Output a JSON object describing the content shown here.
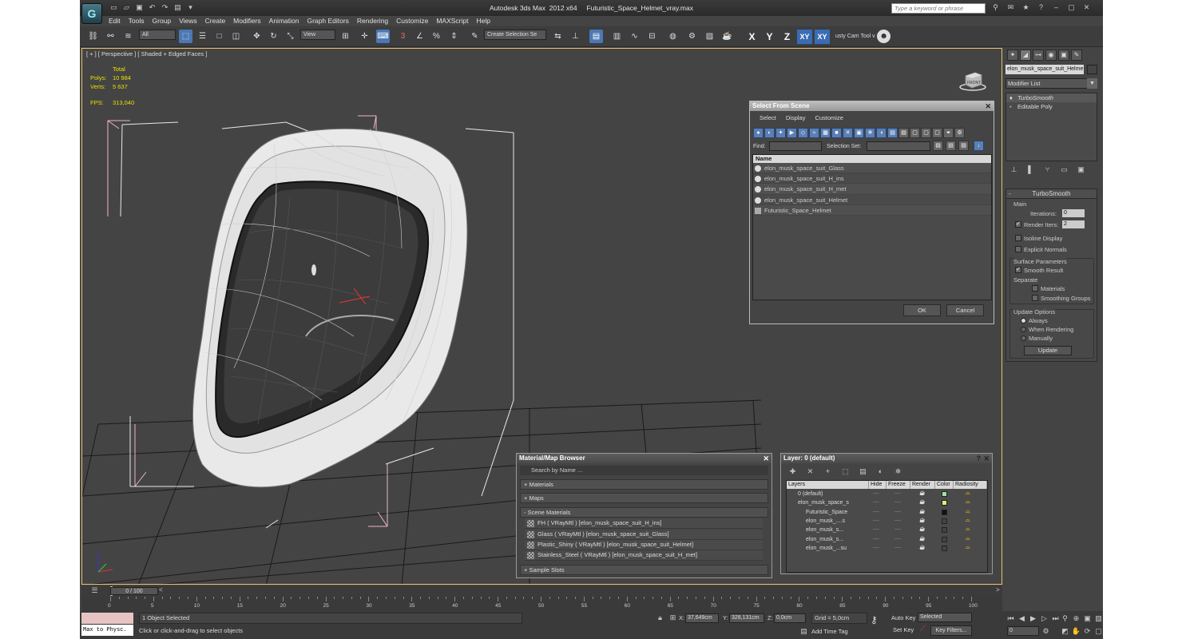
{
  "app": {
    "title": "Autodesk 3ds Max  2012 x64     Futuristic_Space_Helmet_vray.max",
    "search_placeholder": "Type a keyword or phrase",
    "logo": "3ds-max-logo"
  },
  "menu": [
    "Edit",
    "Tools",
    "Group",
    "Views",
    "Create",
    "Modifiers",
    "Animation",
    "Graph Editors",
    "Rendering",
    "Customize",
    "MAXScript",
    "Help"
  ],
  "toolbar": {
    "filter": "All",
    "ref_coord": "View",
    "create_selection_set": "Create Selection Se",
    "snap_label": "3",
    "axes": {
      "x": "X",
      "y": "Y",
      "z": "Z",
      "xy": "XY",
      "xy2": "XY"
    },
    "extra": "usty Cam Tool v"
  },
  "viewport": {
    "label": "[ + ] [ Perspective ] [ Shaded + Edged Faces ]",
    "stats": {
      "total_label": "Total",
      "polys_label": "Polys:",
      "polys": "10 984",
      "verts_label": "Verts:",
      "verts": "5 637",
      "fps_label": "FPS:",
      "fps": "313,040"
    },
    "viewcube_label": "FRONT"
  },
  "select_from_scene": {
    "title": "Select From Scene",
    "menu": [
      "Select",
      "Display",
      "Customize"
    ],
    "find_label": "Find:",
    "selection_set_label": "Selection Set:",
    "column": "Name",
    "rows": [
      "elon_musk_space_suit_Glass",
      "elon_musk_space_suit_H_ins",
      "elon_musk_space_suit_H_met",
      "elon_musk_space_suit_Helmet",
      "Futuristic_Space_Helmet"
    ],
    "ok": "OK",
    "cancel": "Cancel"
  },
  "command_panel": {
    "object_name": "elon_musk_space_suit_Helme",
    "modifier_list": "Modifier List",
    "stack": [
      "TurboSmooth",
      "Editable Poly"
    ]
  },
  "turbosmooth": {
    "header": "TurboSmooth",
    "main": "Main",
    "iterations_label": "Iterations:",
    "iterations": "0",
    "render_iters_label": "Render Iters:",
    "render_iters": "2",
    "isoline": "Isoline Display",
    "explicit": "Explicit Normals",
    "surface_params": "Surface Parameters",
    "smooth_result": "Smooth Result",
    "separate": "Separate",
    "materials": "Materials",
    "smoothing_groups": "Smoothing Groups",
    "update_options": "Update Options",
    "always": "Always",
    "when_rendering": "When Rendering",
    "manually": "Manually",
    "update": "Update"
  },
  "material_browser": {
    "title": "Material/Map Browser",
    "search": "Search by Name ...",
    "materials": "+ Materials",
    "maps": "+ Maps",
    "scene_materials": "- Scene Materials",
    "items": [
      "FH  ( VRayMtl ) [elon_musk_space_suit_H_ins]",
      "Glass  ( VRayMtl ) [elon_musk_space_suit_Glass]",
      "Plastic_Shiny  ( VRayMtl ) [elon_musk_space_suit_Helmet]",
      "Stainless_Steel  ( VRayMtl ) [elon_musk_space_suit_H_met]"
    ],
    "sample_slots": "+ Sample Slots"
  },
  "layer": {
    "title": "Layer: 0 (default)",
    "help": "?",
    "columns": [
      "Layers",
      "Hide",
      "Freeze",
      "Render",
      "Color",
      "Radiosity"
    ],
    "rows": [
      "0 (default)",
      "elon_musk_space_s",
      "Futuristic_Space",
      "elon_musk_....s",
      "elon_musk_s...",
      "elon_musk_s...",
      "elon_musk_...su"
    ],
    "swatches": [
      "#9fe3a6",
      "#e9e97a",
      "#111111",
      "#444444",
      "#444444",
      "#444444",
      "#444444"
    ]
  },
  "timeline": {
    "slider": "0 / 100",
    "ticks": [
      "0",
      "5",
      "10",
      "15",
      "20",
      "25",
      "30",
      "35",
      "40",
      "45",
      "50",
      "55",
      "60",
      "65",
      "70",
      "75",
      "80",
      "85",
      "90",
      "95",
      "100"
    ]
  },
  "status": {
    "maxscript": "Max to Physc.",
    "selected": "1 Object Selected",
    "prompt": "Click or click-and-drag to select objects",
    "x_label": "X:",
    "x": "37,649cm",
    "y_label": "Y:",
    "y": "328,131cm",
    "z_label": "Z:",
    "z": "0,0cm",
    "grid": "Grid = 5,0cm",
    "add_time_tag": "Add Time Tag",
    "auto_key": "Auto Key",
    "set_key": "Set Key",
    "selected_dd": "Selected",
    "key_filters": "Key Filters...",
    "frame": "0"
  },
  "colors": {
    "accent": "#4b78b5",
    "viewport_border": "#e7c16a",
    "stats": "#e8e000"
  }
}
